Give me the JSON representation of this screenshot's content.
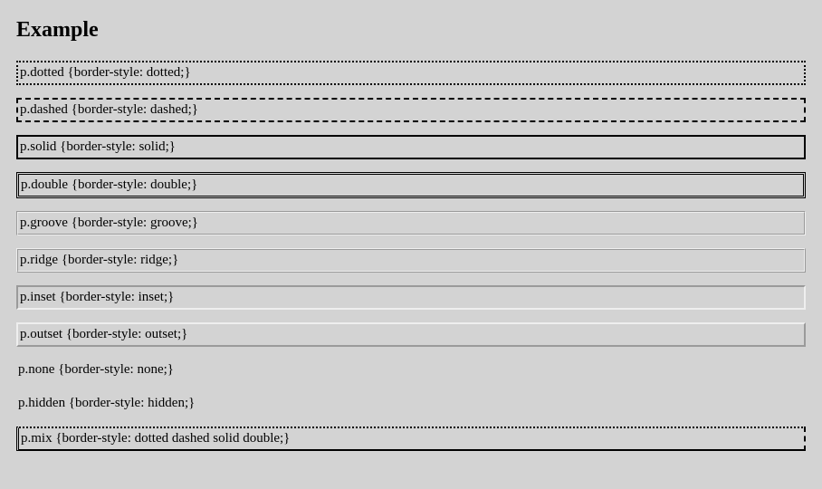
{
  "heading": "Example",
  "rows": [
    {
      "cls": "dotted",
      "text": "p.dotted {border-style: dotted;}"
    },
    {
      "cls": "dashed",
      "text": "p.dashed {border-style: dashed;}"
    },
    {
      "cls": "solid",
      "text": "p.solid {border-style: solid;}"
    },
    {
      "cls": "double",
      "text": "p.double {border-style: double;}"
    },
    {
      "cls": "groove",
      "text": "p.groove {border-style: groove;}"
    },
    {
      "cls": "ridge",
      "text": "p.ridge {border-style: ridge;}"
    },
    {
      "cls": "inset",
      "text": "p.inset {border-style: inset;}"
    },
    {
      "cls": "outset",
      "text": "p.outset {border-style: outset;}"
    },
    {
      "cls": "none",
      "text": "p.none {border-style: none;}"
    },
    {
      "cls": "hidden",
      "text": "p.hidden {border-style: hidden;}"
    },
    {
      "cls": "mix",
      "text": "p.mix {border-style: dotted dashed solid double;}"
    }
  ]
}
